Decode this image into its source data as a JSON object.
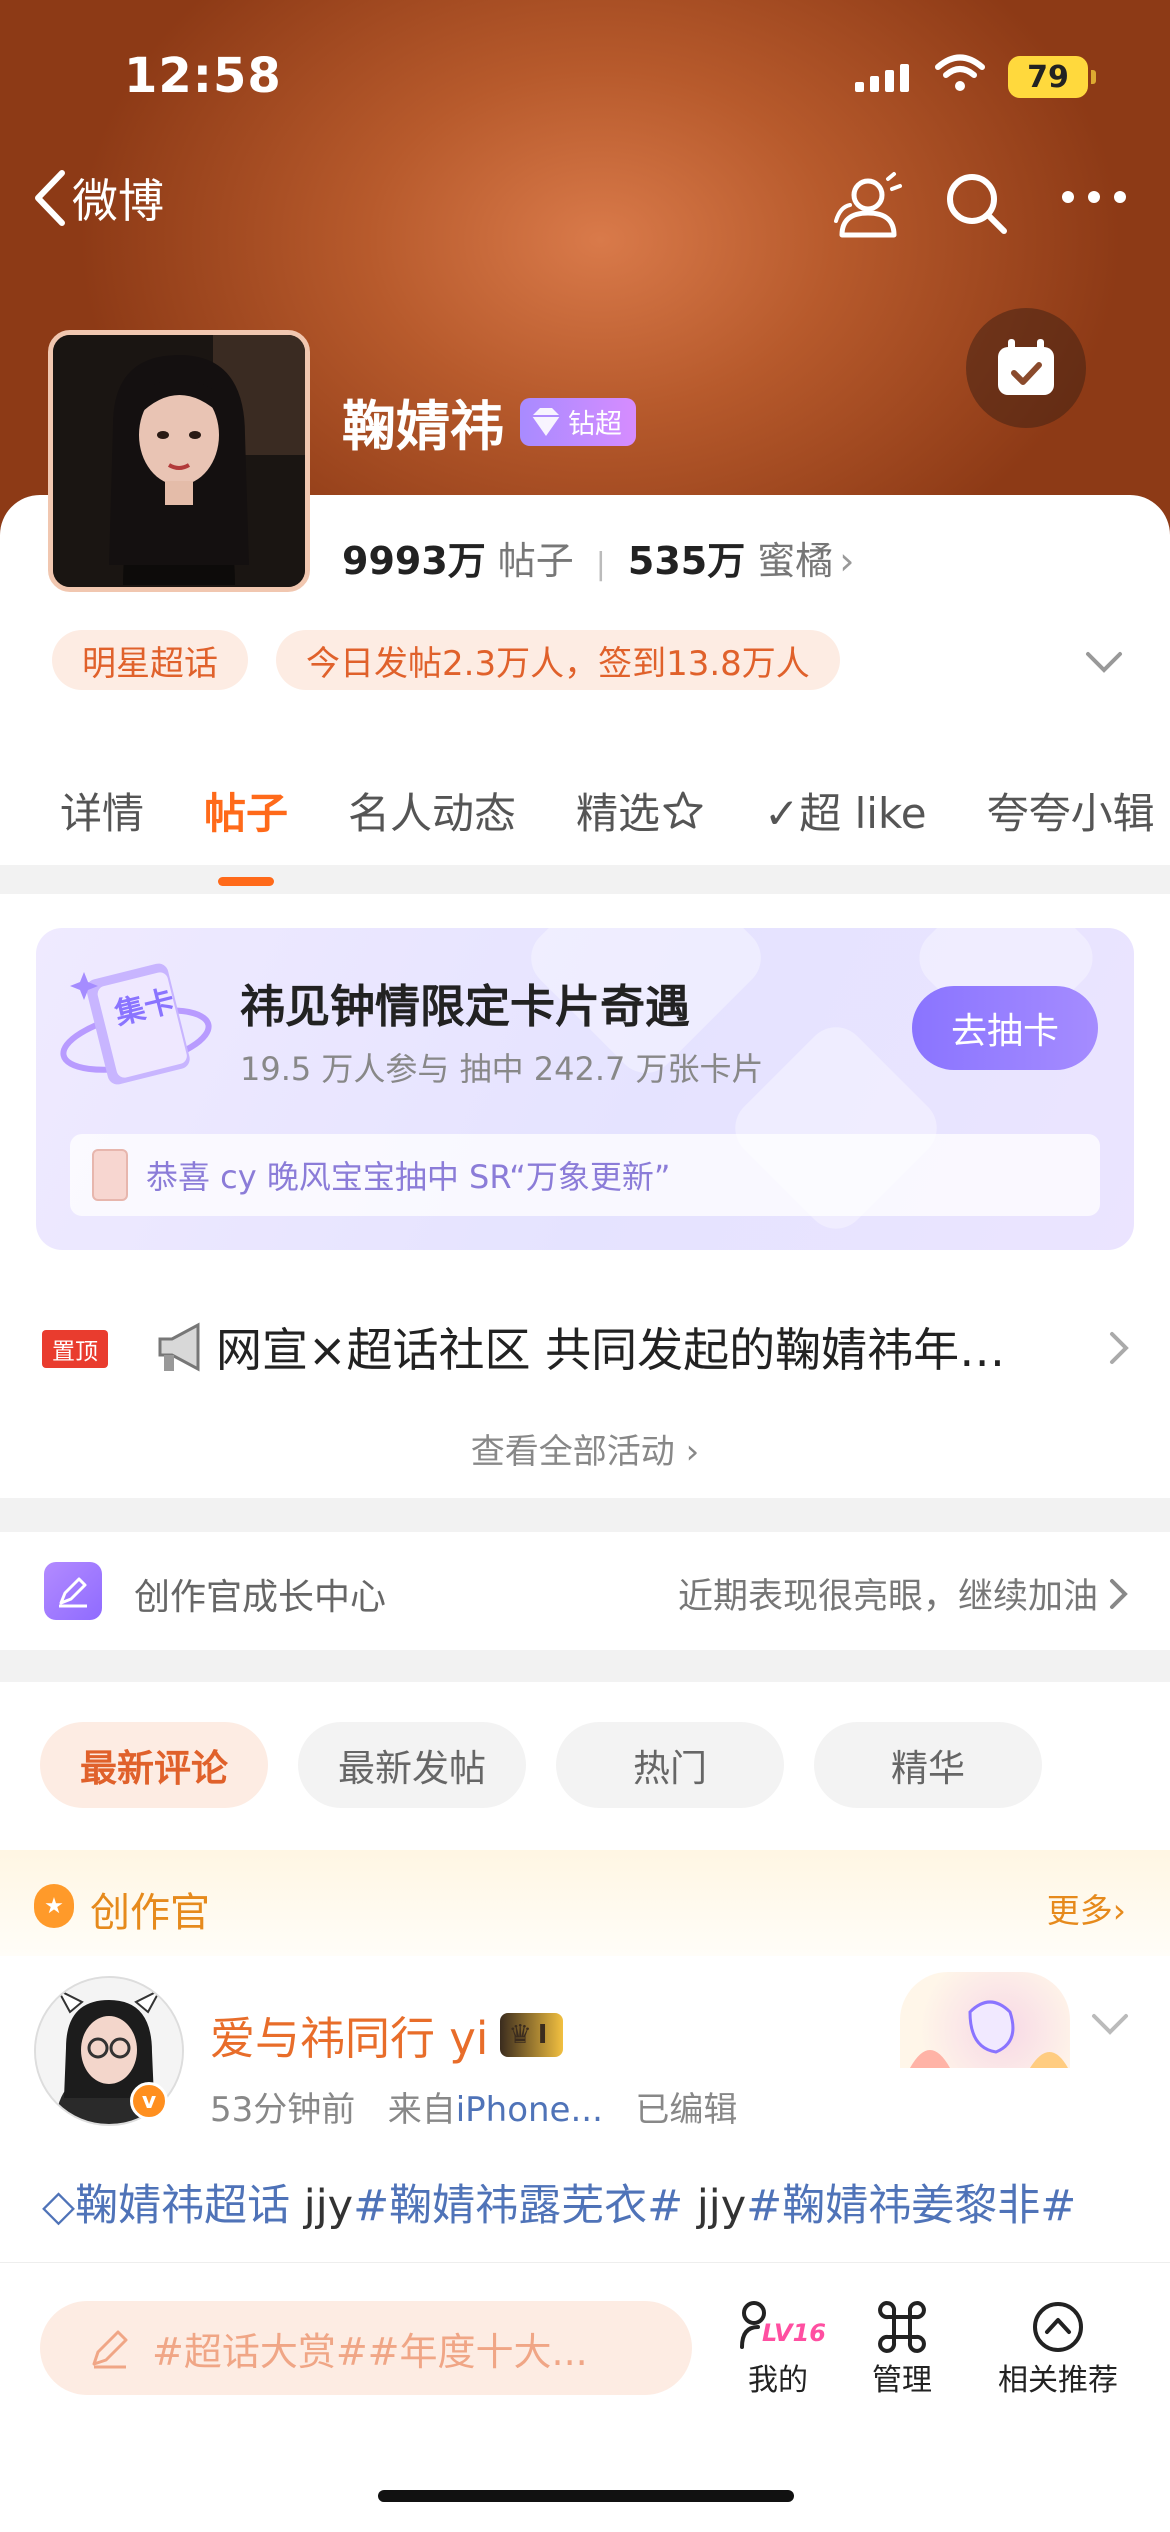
{
  "status_bar": {
    "time": "12:58",
    "battery": "79"
  },
  "nav": {
    "back_label": "微博",
    "icons": [
      "people-icon",
      "search-icon",
      "more-icon"
    ]
  },
  "profile": {
    "name": "鞠婧祎",
    "badge": "钻超",
    "posts_count": "9993万",
    "posts_label": "帖子",
    "fans_count": "535万",
    "fans_label": "蜜橘",
    "tags": [
      "明星超话",
      "今日发帖2.3万人，签到13.8万人"
    ]
  },
  "tabs": [
    "详情",
    "帖子",
    "名人动态",
    "精选",
    "✓超 like",
    "夸夸小辑"
  ],
  "active_tab": 1,
  "promo": {
    "icon_text": "集卡",
    "title": "祎见钟情限定卡片奇遇",
    "subtitle": "19.5 万人参与  抽中 242.7 万张卡片",
    "button": "去抽卡",
    "news": "恭喜 cy 晚风宝宝抽中 SR“万象更新”"
  },
  "pinned": {
    "badge": "置顶",
    "text": "网宣×超话社区 共同发起的鞠婧祎年…",
    "view_all": "查看全部活动 ›"
  },
  "creator_center": {
    "label": "创作官成长中心",
    "right_text": "近期表现很亮眼，继续加油"
  },
  "filters": [
    "最新评论",
    "最新发帖",
    "热门",
    "精华"
  ],
  "active_filter": 0,
  "creator_section": {
    "title": "创作官",
    "more": "更多›"
  },
  "post": {
    "author": "爱与祎同行 yi",
    "level": "I",
    "time": "53分钟前",
    "source_prefix": "来自",
    "source": "iPhone...",
    "edited": "已编辑",
    "topic1": "鞠婧祎超话",
    "body_mid1": "  jjy",
    "topic2": "#鞠婧祎露芜衣#",
    "body_mid2": "  jjy",
    "topic3": "#鞠婧祎姜黎非#"
  },
  "bottom_bar": {
    "composer_placeholder": "#超话大赏##年度十大...",
    "level_badge": "LV16",
    "items": [
      "我的",
      "管理",
      "相关推荐"
    ]
  },
  "colors": {
    "accent": "#ff6a1a",
    "hero": "#b75a2c",
    "promo_button": "#8a74ff",
    "topic_link": "#4f73b8"
  }
}
